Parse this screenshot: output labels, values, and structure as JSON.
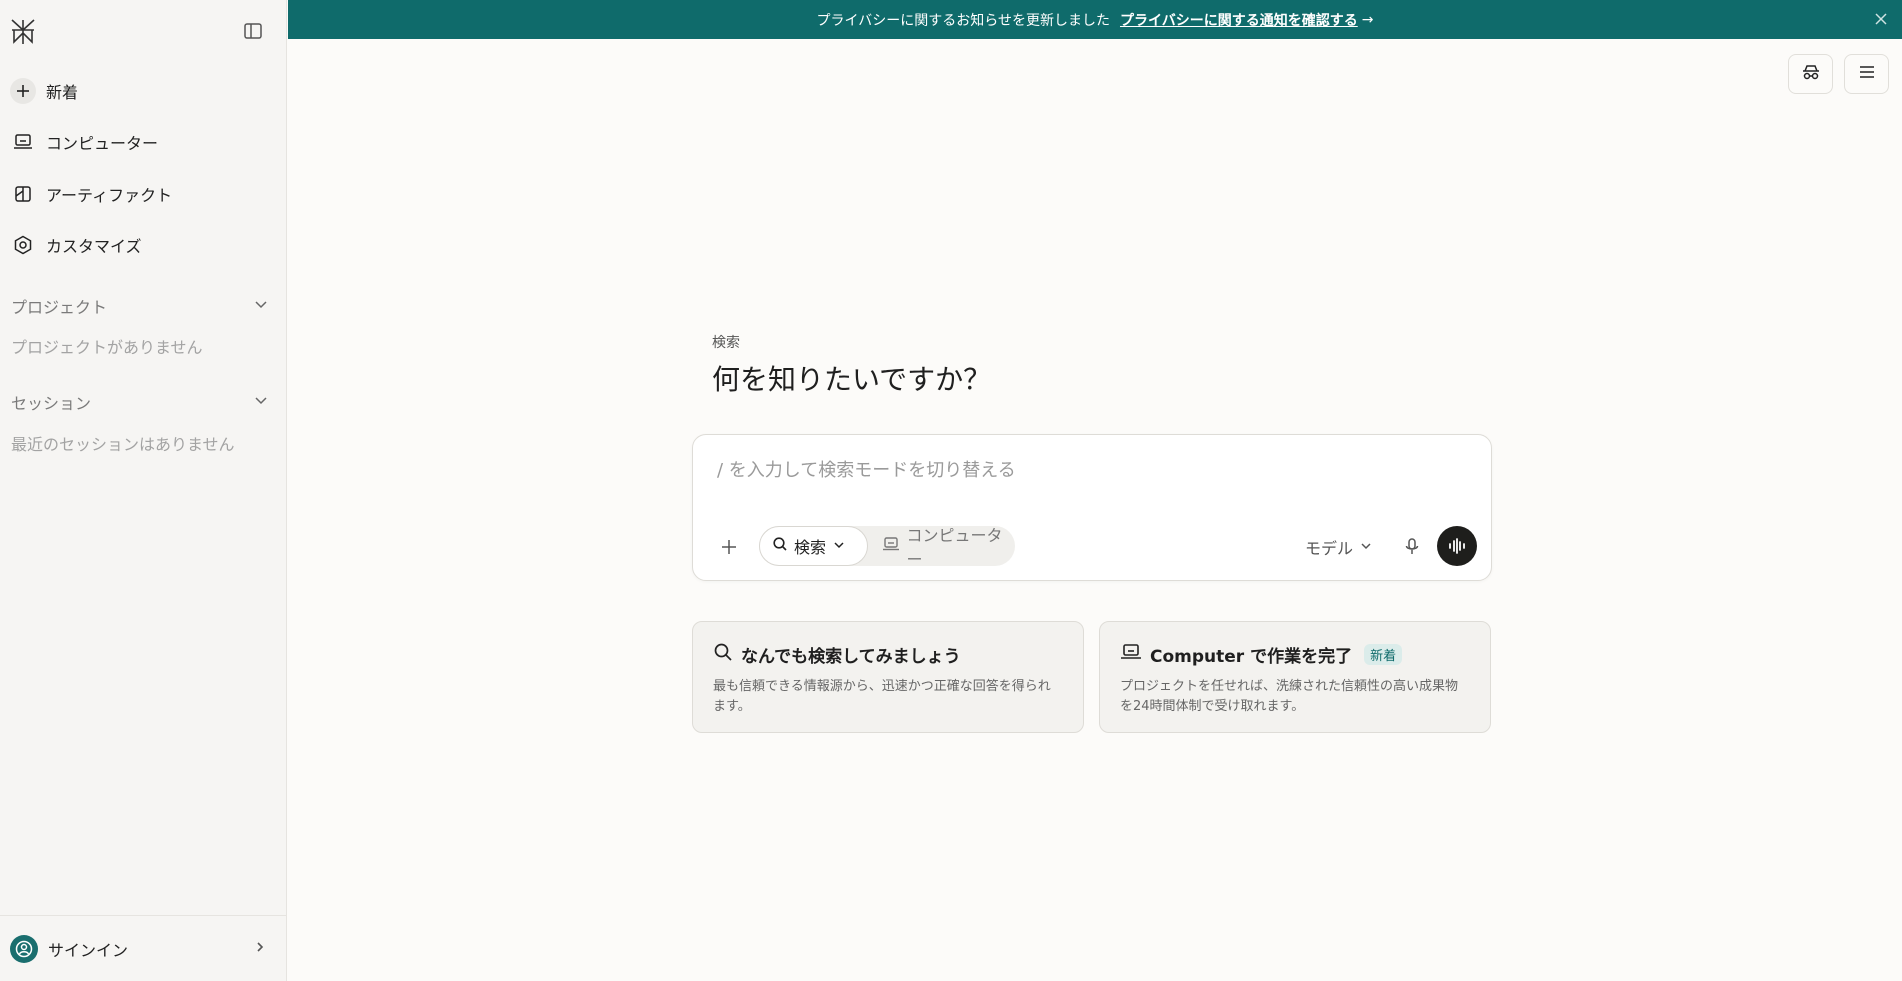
{
  "sidebar": {
    "new_label": "新着",
    "items": [
      {
        "label": "コンピューター"
      },
      {
        "label": "アーティファクト"
      },
      {
        "label": "カスタマイズ"
      }
    ],
    "projects": {
      "title": "プロジェクト",
      "empty": "プロジェクトがありません"
    },
    "sessions": {
      "title": "セッション",
      "empty": "最近のセッションはありません"
    },
    "signin_label": "サインイン"
  },
  "banner": {
    "text": "プライバシーに関するお知らせを更新しました",
    "link": "プライバシーに関する通知を確認する",
    "arrow": "→"
  },
  "main": {
    "mode_label": "検索",
    "headline": "何を知りたいですか？",
    "composer": {
      "placeholder": "/ を入力して検索モードを切り替える",
      "search_mode": "検索",
      "computer_mode": "コンピューター",
      "model_label": "モデル"
    },
    "cards": [
      {
        "title": "なんでも検索してみましょう",
        "desc": "最も信頼できる情報源から、迅速かつ正確な回答を得られます。"
      },
      {
        "title": "Computer で作業を完了",
        "badge": "新着",
        "desc": "プロジェクトを任せれば、洗練された信頼性の高い成果物を24時間体制で受け取れます。"
      }
    ]
  },
  "colors": {
    "accent": "#0f6b6b",
    "banner_bg": "#0f6b6b",
    "voice_button": "#1e1e1c"
  }
}
